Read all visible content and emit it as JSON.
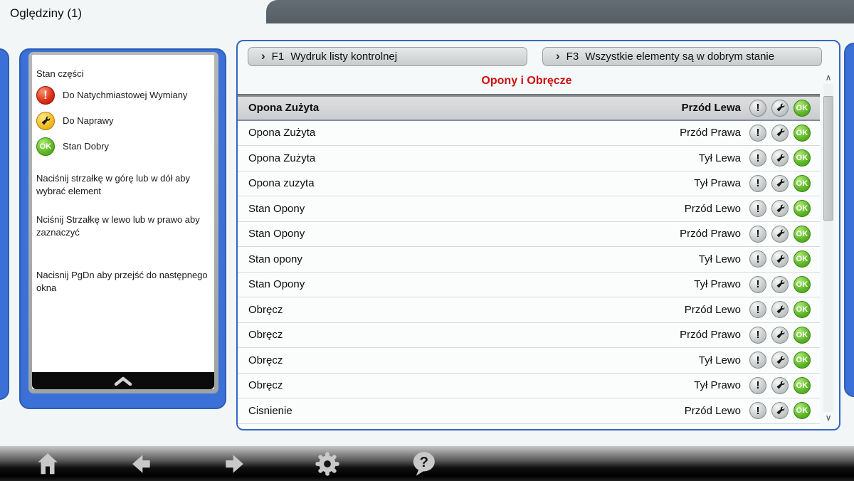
{
  "tab": {
    "title": "Oględziny (1)"
  },
  "legend": {
    "title": "Stan części",
    "items": [
      {
        "icon": "danger-icon",
        "label": "Do Natychmiastowej Wymiany"
      },
      {
        "icon": "repair-icon",
        "label": "Do Naprawy"
      },
      {
        "icon": "ok-icon",
        "label": "Stan Dobry"
      }
    ]
  },
  "instructions": [
    "Naciśnij strzałkę w górę lub w dół aby wybrać element",
    "Nciśnij Strzałkę w lewo lub w prawo aby zaznaczyć",
    "Nacisnij PgDn aby przejść do następnego okna"
  ],
  "function_buttons": [
    {
      "key": "F1",
      "label": "Wydruk listy kontrolnej"
    },
    {
      "key": "F3",
      "label": "Wszystkie elementy są w dobrym stanie"
    }
  ],
  "checklist": {
    "title": "Opony i Obręcze",
    "rows": [
      {
        "name": "Opona Zużyta",
        "position": "Przód Lewa",
        "selected": true
      },
      {
        "name": "Opona Zużyta",
        "position": "Przód Prawa",
        "selected": false
      },
      {
        "name": "Opona Zużyta",
        "position": "Tył Lewa",
        "selected": false
      },
      {
        "name": "Opona zuzyta",
        "position": "Tył Prawa",
        "selected": false
      },
      {
        "name": "Stan Opony",
        "position": "Przód Lewo",
        "selected": false
      },
      {
        "name": "Stan Opony",
        "position": "Przód Prawo",
        "selected": false
      },
      {
        "name": "Stan opony",
        "position": "Tył Lewo",
        "selected": false
      },
      {
        "name": "Stan Opony",
        "position": "Tył Prawo",
        "selected": false
      },
      {
        "name": "Obręcz",
        "position": "Przód Lewo",
        "selected": false
      },
      {
        "name": "Obręcz",
        "position": "Przód Prawo",
        "selected": false
      },
      {
        "name": "Obręcz",
        "position": "Tył Lewo",
        "selected": false
      },
      {
        "name": "Obręcz",
        "position": "Tył Prawo",
        "selected": false
      },
      {
        "name": "Cisnienie",
        "position": "Przód Lewo",
        "selected": false
      }
    ]
  },
  "icons": {
    "warn_text": "!",
    "ok_text": "OK",
    "button_chevron": "›",
    "scroll_up": "∧",
    "scroll_down": "∨",
    "question_mark": "?"
  },
  "colors": {
    "accent_blue": "#3a70d8",
    "panel_border_blue": "#2e5cb0",
    "title_red": "#cc1010",
    "ok_green": "#55b01e",
    "danger_red": "#d43318",
    "repair_yellow": "#f0c028",
    "top_strip_gray": "#5b636b"
  }
}
